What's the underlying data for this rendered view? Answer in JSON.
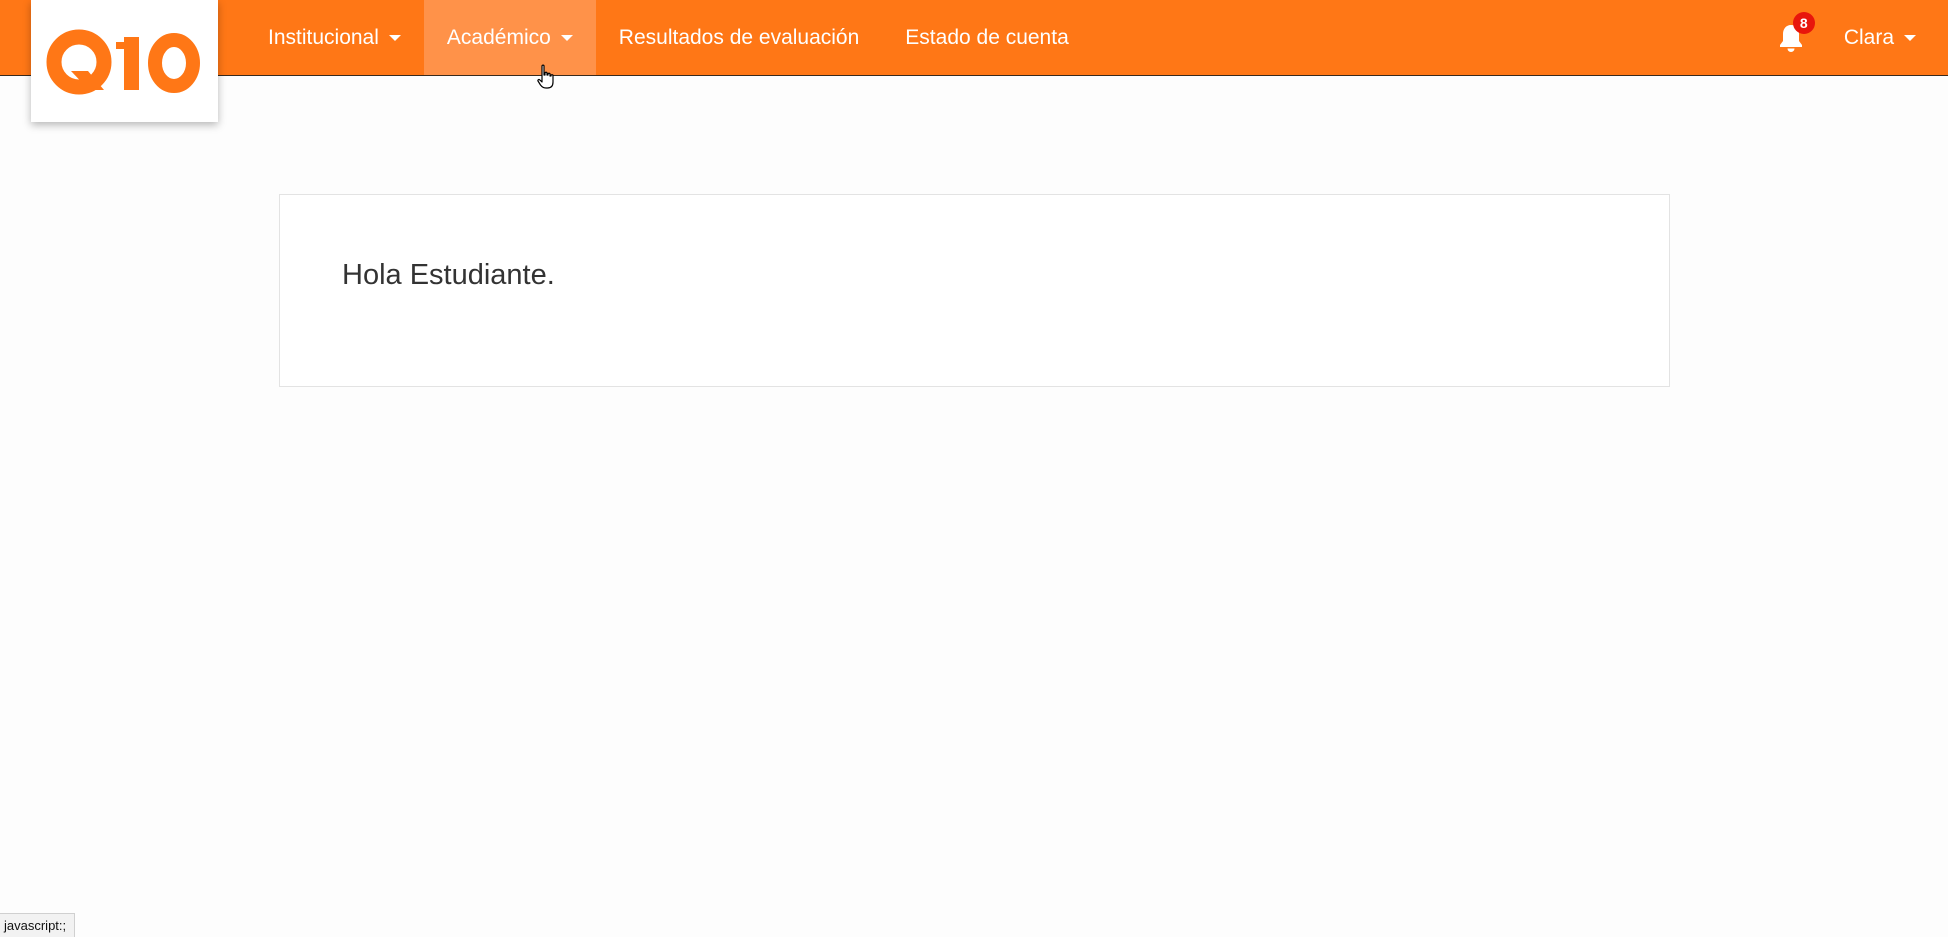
{
  "brand": {
    "logo_text": "Q10",
    "color": "#ff7716"
  },
  "navbar": {
    "items": [
      {
        "label": "Institucional",
        "has_dropdown": true,
        "active": false
      },
      {
        "label": "Académico",
        "has_dropdown": true,
        "active": true
      },
      {
        "label": "Resultados de evaluación",
        "has_dropdown": false,
        "active": false
      },
      {
        "label": "Estado de cuenta",
        "has_dropdown": false,
        "active": false
      }
    ],
    "notifications": {
      "icon": "bell-icon",
      "count": "8",
      "badge_color": "#e8160c"
    },
    "user": {
      "name": "Clara",
      "has_dropdown": true
    }
  },
  "main": {
    "greeting": "Hola Estudiante."
  },
  "status_bar": {
    "text": "javascript:;"
  }
}
